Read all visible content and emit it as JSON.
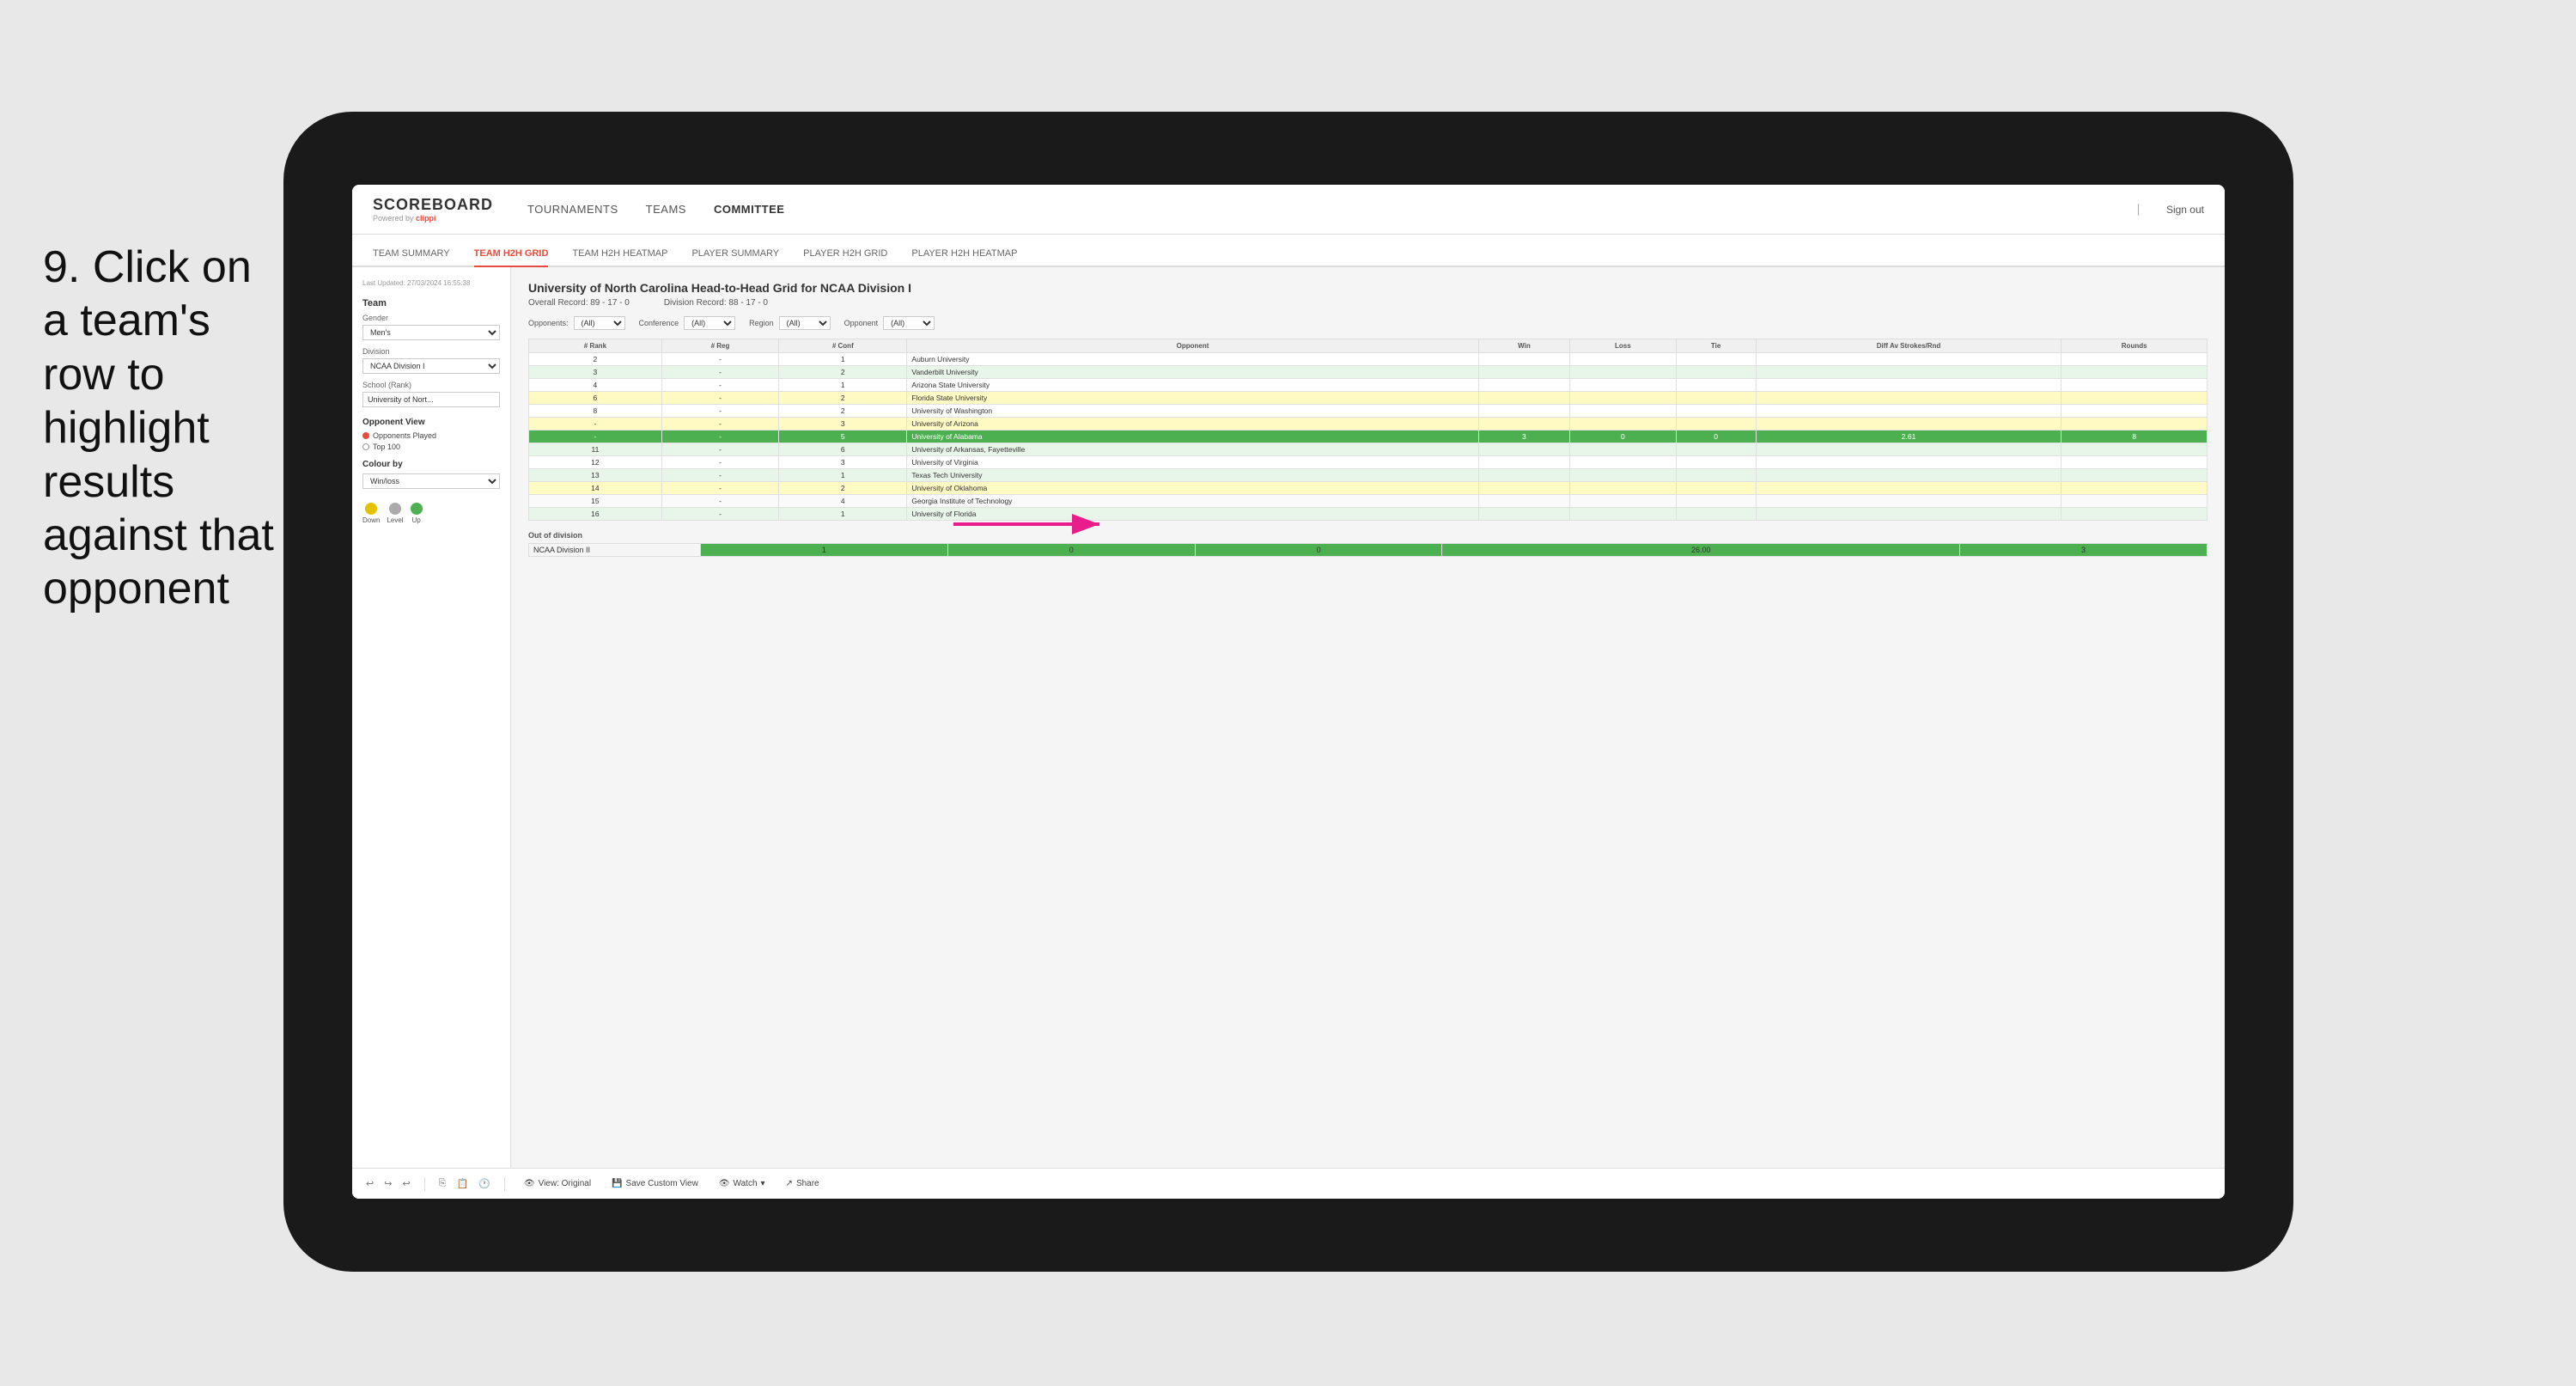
{
  "instruction": {
    "text": "9. Click on a team's row to highlight results against that opponent"
  },
  "tablet": {
    "nav": {
      "logo": "SCOREBOARD",
      "powered_by": "Powered by",
      "brand": "clippi",
      "links": [
        "TOURNAMENTS",
        "TEAMS",
        "COMMITTEE"
      ],
      "sign_out": "Sign out"
    },
    "sub_nav": {
      "links": [
        "TEAM SUMMARY",
        "TEAM H2H GRID",
        "TEAM H2H HEATMAP",
        "PLAYER SUMMARY",
        "PLAYER H2H GRID",
        "PLAYER H2H HEATMAP"
      ],
      "active": "TEAM H2H GRID"
    },
    "left_panel": {
      "last_updated": "Last Updated: 27/03/2024\n16:55:38",
      "team_label": "Team",
      "gender_label": "Gender",
      "gender_value": "Men's",
      "division_label": "Division",
      "division_value": "NCAA Division I",
      "school_rank_label": "School (Rank)",
      "school_rank_value": "University of Nort...",
      "opponent_view_label": "Opponent View",
      "opponents_played": "Opponents Played",
      "top100": "Top 100",
      "colour_by": "Colour by",
      "colour_by_value": "Win/loss",
      "legend": [
        {
          "label": "Down",
          "color": "#e5c100"
        },
        {
          "label": "Level",
          "color": "#aaa"
        },
        {
          "label": "Up",
          "color": "#4CAF50"
        }
      ]
    },
    "grid": {
      "title": "University of North Carolina Head-to-Head Grid for NCAA Division I",
      "overall_record": "Overall Record: 89 - 17 - 0",
      "division_record": "Division Record: 88 - 17 - 0",
      "filters": {
        "opponents_label": "Opponents:",
        "opponents_value": "(All)",
        "conference_label": "Conference",
        "conference_value": "(All)",
        "region_label": "Region",
        "region_value": "(All)",
        "opponent_label": "Opponent",
        "opponent_value": "(All)"
      },
      "columns": [
        "# Rank",
        "# Reg",
        "# Conf",
        "Opponent",
        "Win",
        "Loss",
        "Tie",
        "Diff Av Strokes/Rnd",
        "Rounds"
      ],
      "rows": [
        {
          "rank": "2",
          "reg": "-",
          "conf": "1",
          "opponent": "Auburn University",
          "win": "",
          "loss": "",
          "tie": "",
          "diff": "",
          "rounds": "",
          "style": "normal"
        },
        {
          "rank": "3",
          "reg": "-",
          "conf": "2",
          "opponent": "Vanderbilt University",
          "win": "",
          "loss": "",
          "tie": "",
          "diff": "",
          "rounds": "",
          "style": "light-green"
        },
        {
          "rank": "4",
          "reg": "-",
          "conf": "1",
          "opponent": "Arizona State University",
          "win": "",
          "loss": "",
          "tie": "",
          "diff": "",
          "rounds": "",
          "style": "normal"
        },
        {
          "rank": "6",
          "reg": "-",
          "conf": "2",
          "opponent": "Florida State University",
          "win": "",
          "loss": "",
          "tie": "",
          "diff": "",
          "rounds": "",
          "style": "yellow"
        },
        {
          "rank": "8",
          "reg": "-",
          "conf": "2",
          "opponent": "University of Washington",
          "win": "",
          "loss": "",
          "tie": "",
          "diff": "",
          "rounds": "",
          "style": "normal"
        },
        {
          "rank": "-",
          "reg": "-",
          "conf": "3",
          "opponent": "University of Arizona",
          "win": "",
          "loss": "",
          "tie": "",
          "diff": "",
          "rounds": "",
          "style": "yellow"
        },
        {
          "rank": "-",
          "reg": "-",
          "conf": "5",
          "opponent": "University of Alabama",
          "win": "3",
          "loss": "0",
          "tie": "0",
          "diff": "2.61",
          "rounds": "8",
          "style": "highlighted"
        },
        {
          "rank": "11",
          "reg": "-",
          "conf": "6",
          "opponent": "University of Arkansas, Fayetteville",
          "win": "",
          "loss": "",
          "tie": "",
          "diff": "",
          "rounds": "",
          "style": "light-green"
        },
        {
          "rank": "12",
          "reg": "-",
          "conf": "3",
          "opponent": "University of Virginia",
          "win": "",
          "loss": "",
          "tie": "",
          "diff": "",
          "rounds": "",
          "style": "normal"
        },
        {
          "rank": "13",
          "reg": "-",
          "conf": "1",
          "opponent": "Texas Tech University",
          "win": "",
          "loss": "",
          "tie": "",
          "diff": "",
          "rounds": "",
          "style": "light-green"
        },
        {
          "rank": "14",
          "reg": "-",
          "conf": "2",
          "opponent": "University of Oklahoma",
          "win": "",
          "loss": "",
          "tie": "",
          "diff": "",
          "rounds": "",
          "style": "yellow"
        },
        {
          "rank": "15",
          "reg": "-",
          "conf": "4",
          "opponent": "Georgia Institute of Technology",
          "win": "",
          "loss": "",
          "tie": "",
          "diff": "",
          "rounds": "",
          "style": "normal"
        },
        {
          "rank": "16",
          "reg": "-",
          "conf": "1",
          "opponent": "University of Florida",
          "win": "",
          "loss": "",
          "tie": "",
          "diff": "",
          "rounds": "",
          "style": "light-green"
        }
      ],
      "out_of_division_label": "Out of division",
      "out_of_division_row": {
        "label": "NCAA Division II",
        "win": "1",
        "loss": "0",
        "tie": "0",
        "diff": "26.00",
        "rounds": "3"
      }
    },
    "toolbar": {
      "view_original": "View: Original",
      "save_custom_view": "Save Custom View",
      "watch": "Watch",
      "share": "Share"
    }
  }
}
